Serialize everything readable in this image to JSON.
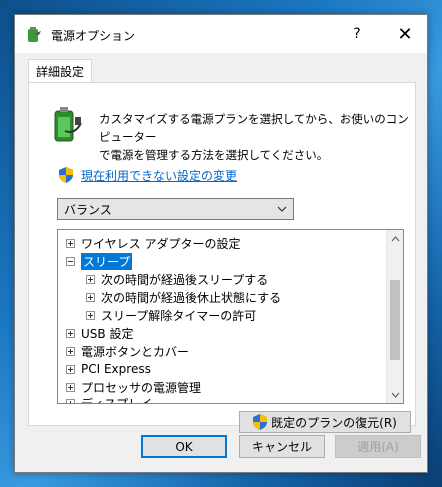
{
  "window": {
    "title": "電源オプション",
    "help_label": "?",
    "close_label": "✕"
  },
  "tab": {
    "label": "詳細設定"
  },
  "description": {
    "line1": "カスタマイズする電源プランを選択してから、お使いのコンピューター",
    "line2": "で電源を管理する方法を選択してください。"
  },
  "link": {
    "label": "現在利用できない設定の変更"
  },
  "plan_select": {
    "selected": "バランス"
  },
  "tree": {
    "items": [
      {
        "label": "ワイヤレス アダプターの設定",
        "expander": "plus",
        "level": 0
      },
      {
        "label": "スリープ",
        "expander": "minus",
        "level": 0,
        "selected": true
      },
      {
        "label": "次の時間が経過後スリープする",
        "expander": "plus",
        "level": 1
      },
      {
        "label": "次の時間が経過後休止状態にする",
        "expander": "plus",
        "level": 1
      },
      {
        "label": "スリープ解除タイマーの許可",
        "expander": "plus",
        "level": 1
      },
      {
        "label": "USB 設定",
        "expander": "plus",
        "level": 0
      },
      {
        "label": "電源ボタンとカバー",
        "expander": "plus",
        "level": 0
      },
      {
        "label": "PCI Express",
        "expander": "plus",
        "level": 0
      },
      {
        "label": "プロセッサの電源管理",
        "expander": "plus",
        "level": 0
      },
      {
        "label": "ディスプレイ",
        "expander": "plus",
        "level": 0
      }
    ]
  },
  "buttons": {
    "restore": "既定のプランの復元(R)",
    "ok": "OK",
    "cancel": "キャンセル",
    "apply": "適用(A)"
  },
  "colors": {
    "selection": "#0078d7",
    "link": "#0066cc"
  }
}
